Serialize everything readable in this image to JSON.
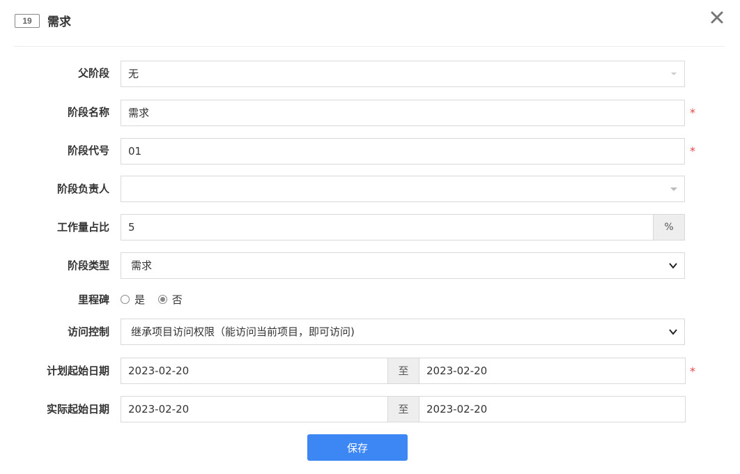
{
  "header": {
    "id_badge": "19",
    "title": "需求",
    "close_icon": "close-icon"
  },
  "form": {
    "parent_stage": {
      "label": "父阶段",
      "value": "无"
    },
    "stage_name": {
      "label": "阶段名称",
      "value": "需求",
      "required": "*"
    },
    "stage_code": {
      "label": "阶段代号",
      "value": "01",
      "required": "*"
    },
    "stage_owner": {
      "label": "阶段负责人",
      "value": ""
    },
    "workload": {
      "label": "工作量占比",
      "value": "5",
      "unit": "%"
    },
    "stage_type": {
      "label": "阶段类型",
      "value": "需求"
    },
    "milestone": {
      "label": "里程碑",
      "options": [
        {
          "label": "是",
          "checked": false
        },
        {
          "label": "否",
          "checked": true
        }
      ]
    },
    "access_control": {
      "label": "访问控制",
      "value": "继承项目访问权限（能访问当前项目，即可访问)"
    },
    "planned_dates": {
      "label": "计划起始日期",
      "start": "2023-02-20",
      "separator": "至",
      "end": "2023-02-20",
      "required": "*"
    },
    "actual_dates": {
      "label": "实际起始日期",
      "start": "2023-02-20",
      "separator": "至",
      "end": "2023-02-20"
    }
  },
  "actions": {
    "save_label": "保存"
  },
  "colors": {
    "primary": "#3d87f5",
    "required": "#e64545",
    "border": "#d9d9d9",
    "addon_bg": "#eeeeee"
  }
}
